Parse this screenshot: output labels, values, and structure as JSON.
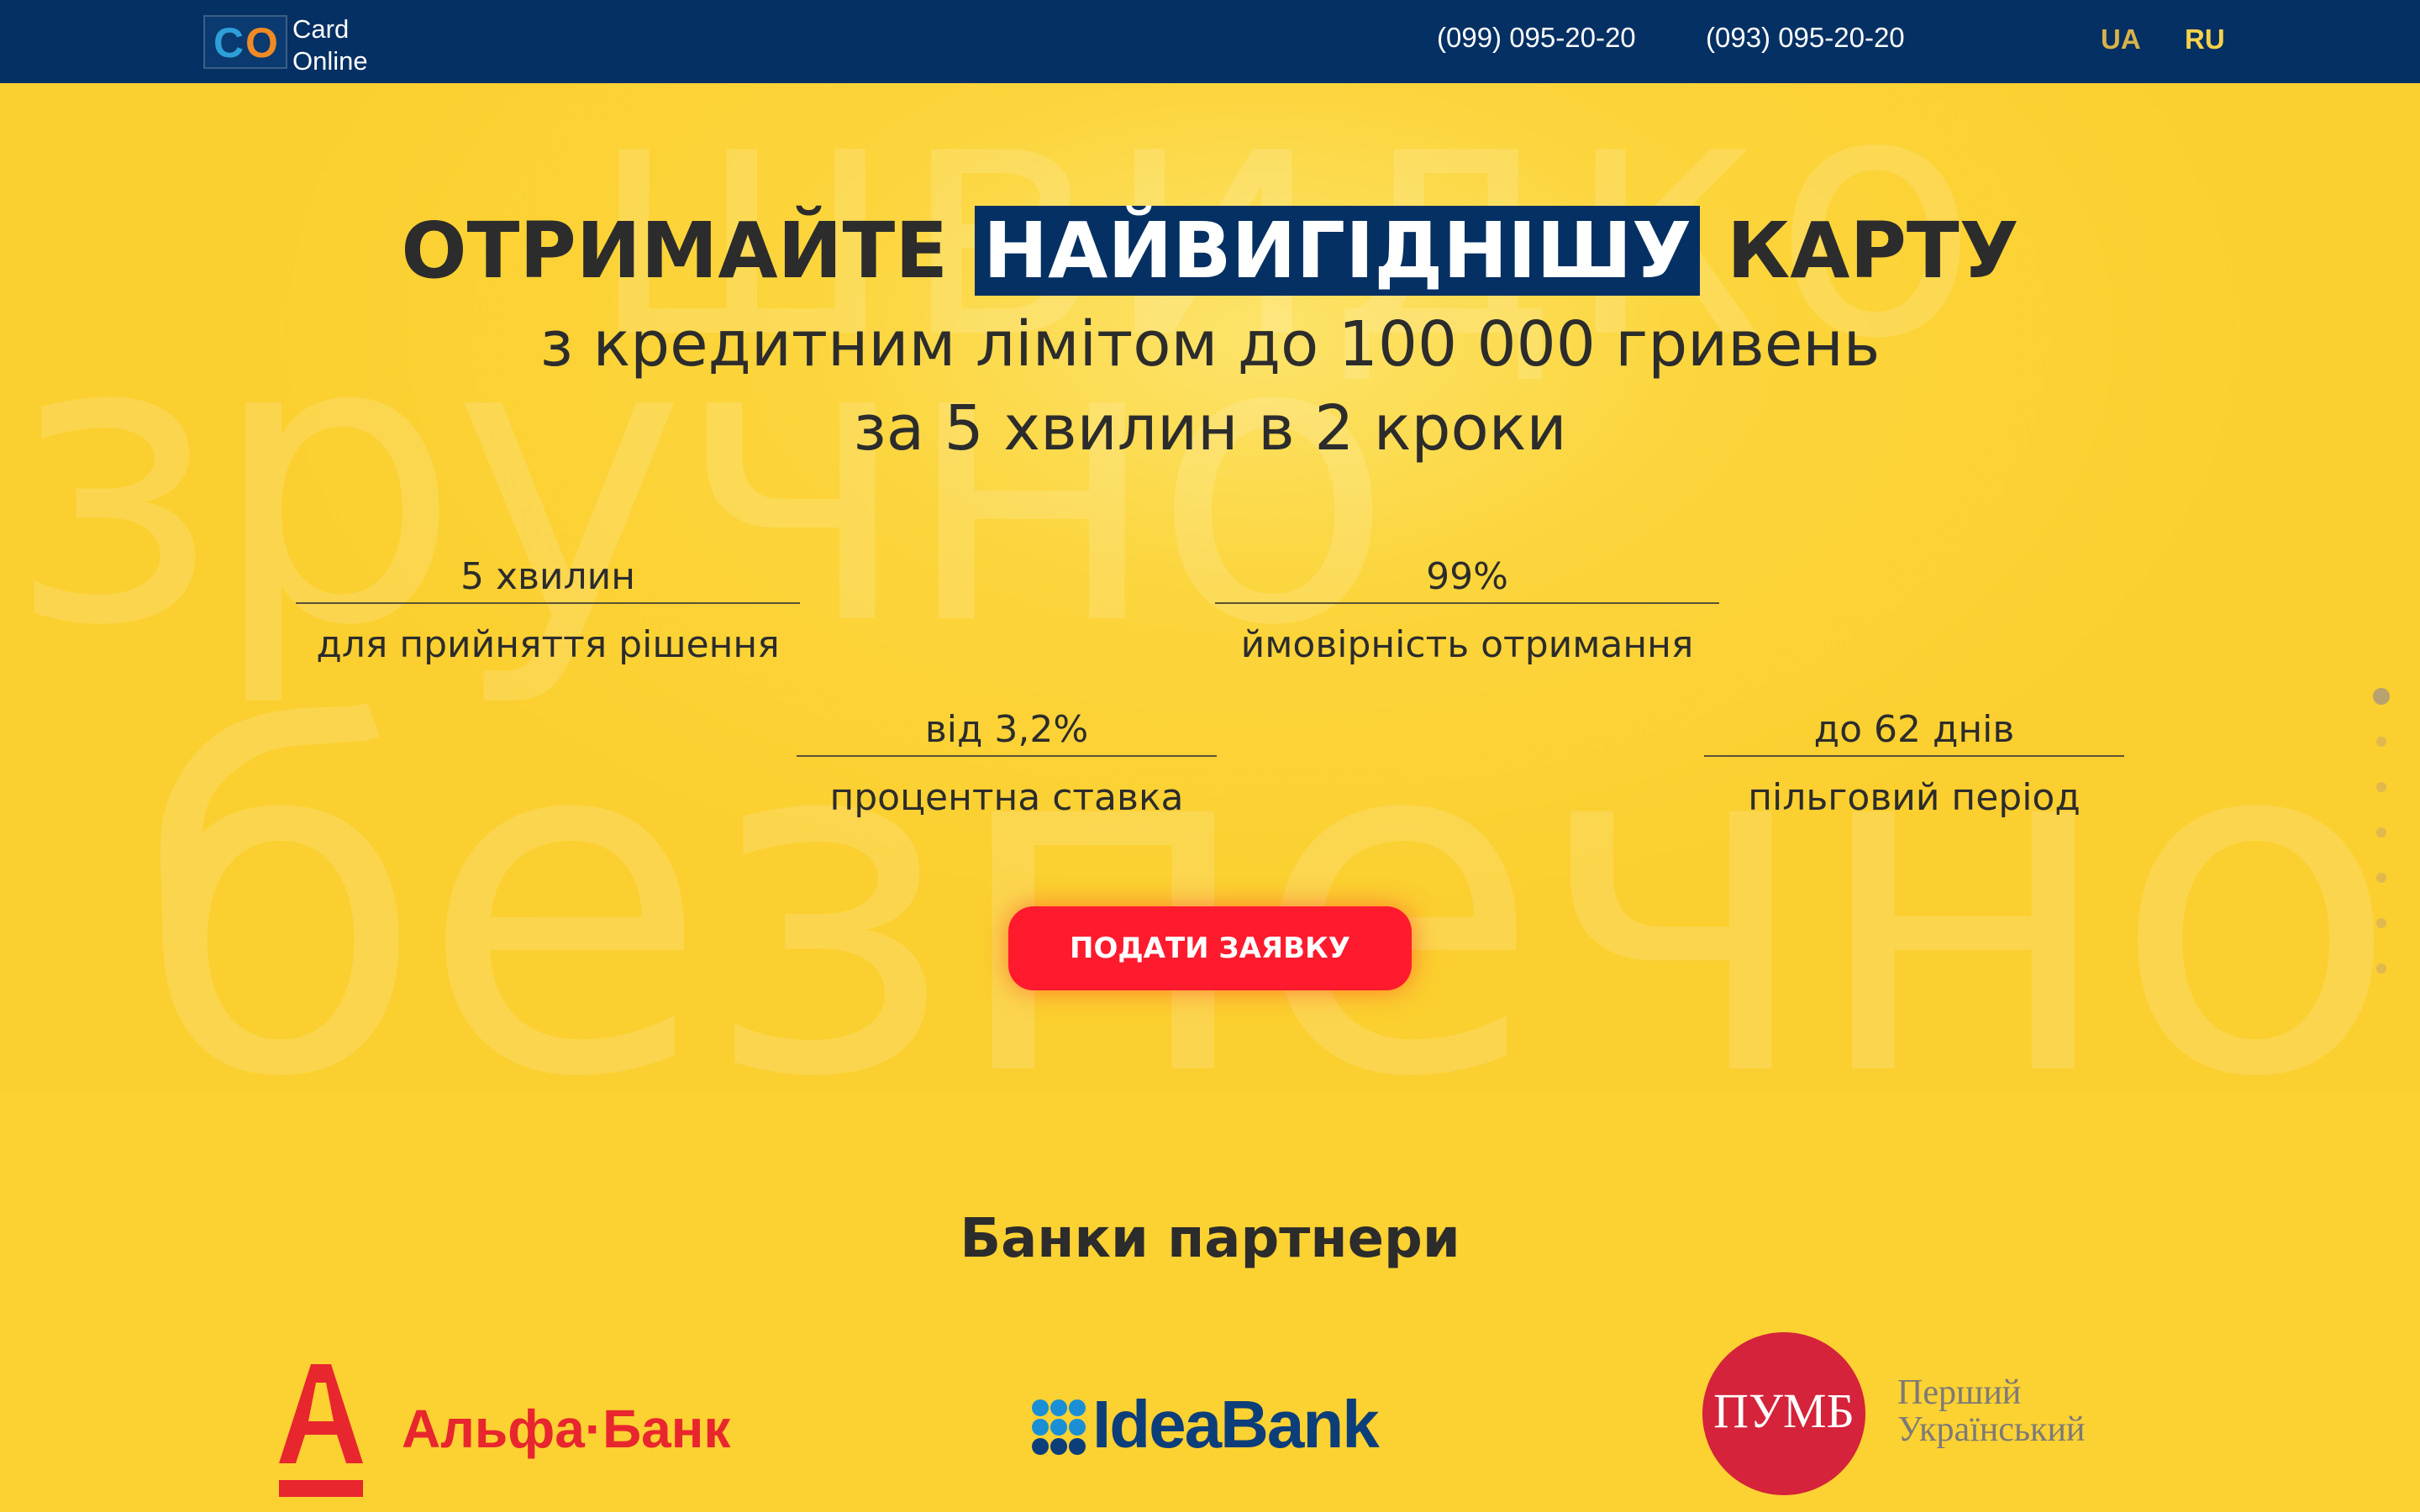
{
  "header": {
    "logo_mark": "CO",
    "logo_line1": "Card",
    "logo_line2": "Online",
    "phone1": "(099) 095-20-20",
    "phone2": "(093) 095-20-20",
    "lang_ua": "UA",
    "lang_ru": "RU"
  },
  "hero": {
    "bg_word1": "швидко",
    "bg_word2": "зручно",
    "bg_word3": "безпечно",
    "headline_pre": "ОТРИМАЙТЕ ",
    "headline_highlight": "НАЙВИГІДНІШУ",
    "headline_post": " КАРТУ",
    "subline1": "з кредитним лімітом до 100 000 гривень",
    "subline2": "за 5 хвилин в 2 кроки",
    "stats": [
      {
        "value": "5 хвилин",
        "label": "для прийняття рішення"
      },
      {
        "value": "99%",
        "label": "ймовірність отримання"
      },
      {
        "value": "від 3,2%",
        "label": "процентна ставка"
      },
      {
        "value": "до 62 днів",
        "label": "пільговий період"
      }
    ],
    "cta_label": "ПОДАТИ ЗАЯВКУ",
    "slide_count": 7,
    "active_slide": 1
  },
  "partners": {
    "title": "Банки партнери",
    "alfa_name": "Альфа·Банк",
    "idea_name": "IdeaBank",
    "pumb_mark": "ПУМБ",
    "pumb_line1": "Перший",
    "pumb_line2": "Український"
  },
  "colors": {
    "header_bg": "#053063",
    "page_bg": "#fcd132",
    "cta_red": "#ff1a2e",
    "alfa_red": "#e8262e",
    "idea_blue": "#0c3e7a",
    "pumb_red": "#d4233a"
  }
}
